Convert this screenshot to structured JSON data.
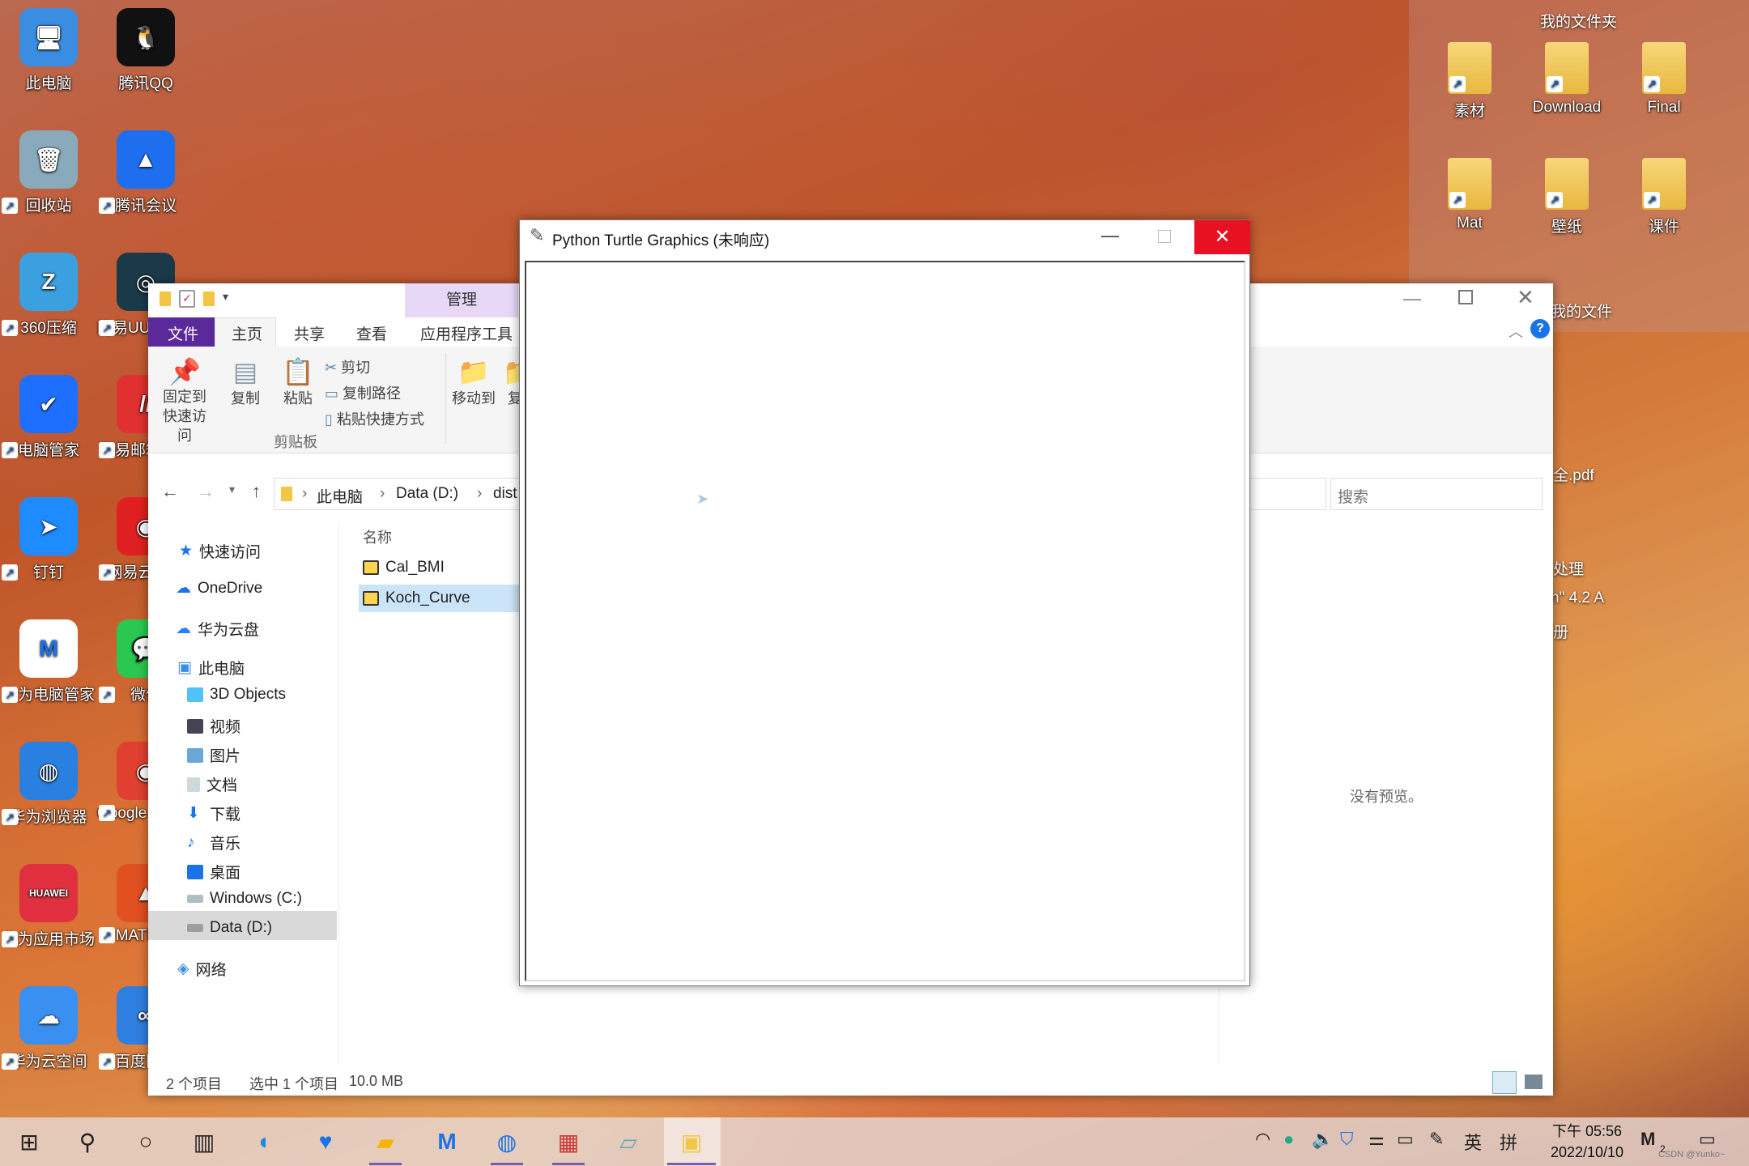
{
  "desktop": {
    "left_icons": [
      {
        "label": "此电脑",
        "color": "#3a8de0",
        "glyph": "🖥"
      },
      {
        "label": "腾讯QQ",
        "color": "#111",
        "glyph": "🐧"
      },
      {
        "label": "回收站",
        "color": "#8ab",
        "glyph": "🗑"
      },
      {
        "label": "腾讯会议",
        "color": "#1e6ff0",
        "glyph": "▲"
      },
      {
        "label": "360压缩",
        "color": "#3aa0e0",
        "glyph": "Z"
      },
      {
        "label": "网易UU加速器",
        "color": "#1a3a4a",
        "glyph": "◎"
      },
      {
        "label": "电脑管家",
        "color": "#1f6fff",
        "glyph": "✔"
      },
      {
        "label": "网易邮箱大师",
        "color": "#e03030",
        "glyph": "//"
      },
      {
        "label": "钉钉",
        "color": "#1e8cff",
        "glyph": "➤"
      },
      {
        "label": "网易云音乐",
        "color": "#e02020",
        "glyph": "◉"
      },
      {
        "label": "华为电脑管家",
        "color": "#ffffff",
        "glyph": "M"
      },
      {
        "label": "微信",
        "color": "#2ac850",
        "glyph": "💬"
      },
      {
        "label": "华为浏览器",
        "color": "#2a80e0",
        "glyph": "◍"
      },
      {
        "label": "Google Chrome",
        "color": "#e04030",
        "glyph": "◉"
      },
      {
        "label": "华为应用市场",
        "color": "#e03040",
        "glyph": "HUAWEI"
      },
      {
        "label": "MATLAB",
        "color": "#e05020",
        "glyph": "▲"
      },
      {
        "label": "华为云空间",
        "color": "#3a90f0",
        "glyph": "☁"
      },
      {
        "label": "百度网盘",
        "color": "#2f7fe0",
        "glyph": "∞"
      }
    ],
    "right_group_title": "我的文件夹",
    "right_icons": [
      {
        "label": "素材"
      },
      {
        "label": "Download"
      },
      {
        "label": "Final"
      },
      {
        "label": "Mat"
      },
      {
        "label": "壁纸"
      },
      {
        "label": "课件"
      }
    ],
    "bg_partial_texts": [
      "我的文件",
      "全.pdf",
      "处理",
      "n\" 4.2 A",
      "册"
    ]
  },
  "explorer": {
    "title_tab": "管理",
    "tabs": [
      "文件",
      "主页",
      "共享",
      "查看",
      "应用程序工具"
    ],
    "ribbon": {
      "pin": "固定到快速访问",
      "copy": "复制",
      "paste": "粘贴",
      "cut": "剪切",
      "copy_path": "复制路径",
      "paste_shortcut": "粘贴快捷方式",
      "group_clipboard": "剪贴板",
      "move_to": "移动到",
      "copy_to": "复"
    },
    "breadcrumb": [
      "此电脑",
      "Data (D:)",
      "dist"
    ],
    "search_placeholder": "搜索",
    "column_name": "名称",
    "files": [
      "Cal_BMI",
      "Koch_Curve"
    ],
    "nav": {
      "quick_access": "快速访问",
      "onedrive": "OneDrive",
      "huawei_cloud": "华为云盘",
      "this_pc": "此电脑",
      "items": [
        "3D Objects",
        "视频",
        "图片",
        "文档",
        "下载",
        "音乐",
        "桌面",
        "Windows (C:)",
        "Data (D:)"
      ],
      "network": "网络"
    },
    "preview_text": "没有预览。",
    "status": {
      "count": "2 个项目",
      "selected": "选中 1 个项目",
      "size": "10.0 MB"
    }
  },
  "turtle": {
    "title": "Python Turtle Graphics (未响应)"
  },
  "taskbar": {
    "time": "下午 05:56",
    "date": "2022/10/10",
    "ime": "英",
    "ime2": "拼",
    "watermark": "CSDN @Yunko~",
    "notif_count": "2"
  }
}
